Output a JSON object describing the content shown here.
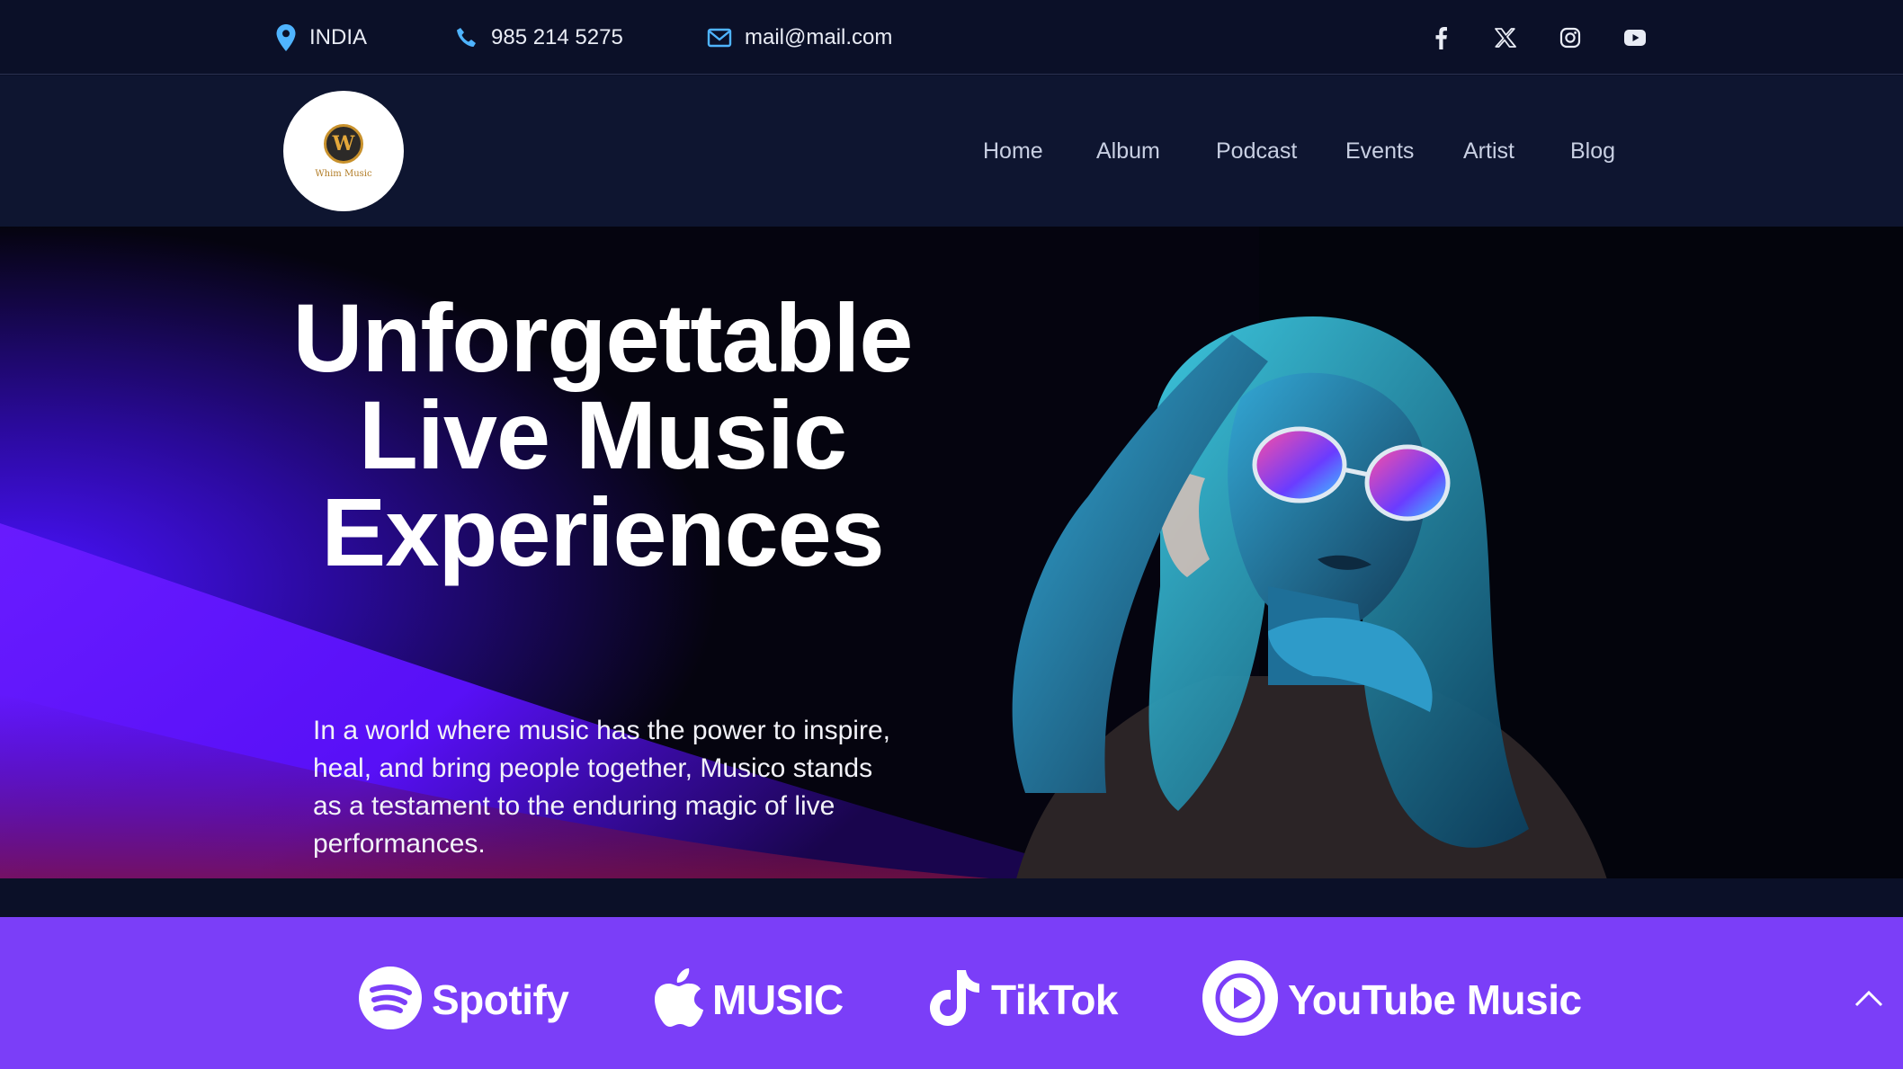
{
  "topbar": {
    "location": "INDIA",
    "phone": "985 214 5275",
    "email": "mail@mail.com",
    "social": [
      "facebook-icon",
      "x-icon",
      "instagram-icon",
      "youtube-icon"
    ]
  },
  "header": {
    "logo_text": "Whim Music",
    "logo_letter": "W",
    "nav": [
      "Home",
      "Album",
      "Podcast",
      "Events",
      "Artist",
      "Blog"
    ]
  },
  "hero": {
    "title_lines": [
      "Unforgettable",
      "Live Music",
      "Experiences"
    ],
    "description": "In a world where music has the power to inspire, heal, and bring people together, Musico stands as a testament to the enduring magic of live performances."
  },
  "platforms": [
    "Spotify",
    "MUSIC",
    "TikTok",
    "YouTube Music"
  ],
  "colors": {
    "topbar_bg": "#0b1028",
    "header_bg": "#0e1530",
    "accent_purple": "#7b3ef8",
    "icon_blue": "#4fb4ff",
    "hero_glow": "#5a1cff"
  }
}
